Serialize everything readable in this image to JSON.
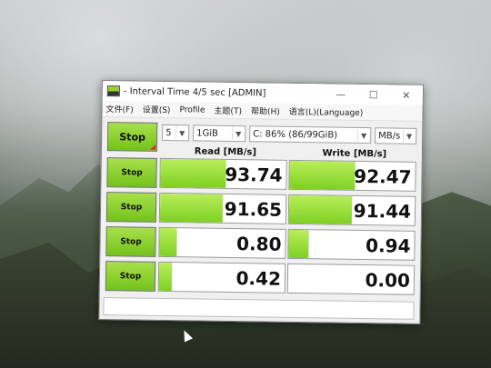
{
  "window": {
    "title": "- Interval Time 4/5 sec [ADMIN]",
    "min_label": "—",
    "max_label": "☐",
    "close_label": "✕"
  },
  "menu": [
    "文件(F)",
    "设置(S)",
    "Profile",
    "主题(T)",
    "帮助(H)",
    "语言(L)(Language)"
  ],
  "controls": {
    "main_button": "Stop",
    "count": "5",
    "size": "1GiB",
    "drive": "C: 86% (86/99GiB)",
    "unit": "MB/s"
  },
  "headers": {
    "read": "Read [MB/s]",
    "write": "Write [MB/s]"
  },
  "rows": [
    {
      "button": "Stop",
      "read": "93.74",
      "write": "92.47",
      "read_level": 0.52,
      "write_level": 0.52
    },
    {
      "button": "Stop",
      "read": "91.65",
      "write": "91.44",
      "read_level": 0.5,
      "write_level": 0.5
    },
    {
      "button": "Stop",
      "read": "0.80",
      "write": "0.94",
      "read_level": 0.14,
      "write_level": 0.16
    },
    {
      "button": "Stop",
      "read": "0.42",
      "write": "0.00",
      "read_level": 0.1,
      "write_level": 0.0
    }
  ],
  "colors": {
    "accent_green": "#7fd023",
    "stop_corner": "#d9381e"
  }
}
